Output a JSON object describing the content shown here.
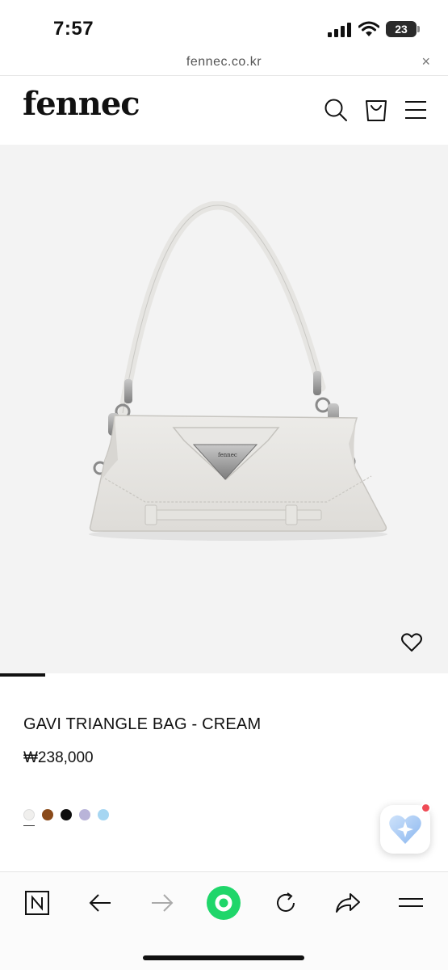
{
  "status_bar": {
    "time": "7:57",
    "battery": "23"
  },
  "browser": {
    "url": "fennec.co.kr",
    "close_label": "×"
  },
  "site": {
    "logo": "fennec"
  },
  "product": {
    "name": "GAVI TRIANGLE BAG - CREAM",
    "price": "₩238,000",
    "image_slide_progress": 0.1,
    "swatches": [
      "#f0efed",
      "#8a4a1a",
      "#0d0d0d",
      "#b9b4d9",
      "#a6d6f2"
    ],
    "selected_swatch": 0
  },
  "colors": {
    "hero_bg": "#f3f3f3",
    "accent_green": "#1fd66a"
  },
  "icons": {
    "header": [
      "search-icon",
      "shopping-bag-icon",
      "menu-icon"
    ],
    "toolbar": [
      "naver-icon",
      "back-arrow-icon",
      "forward-arrow-icon",
      "green-dot-icon",
      "reload-icon",
      "share-icon",
      "menu-icon"
    ]
  }
}
